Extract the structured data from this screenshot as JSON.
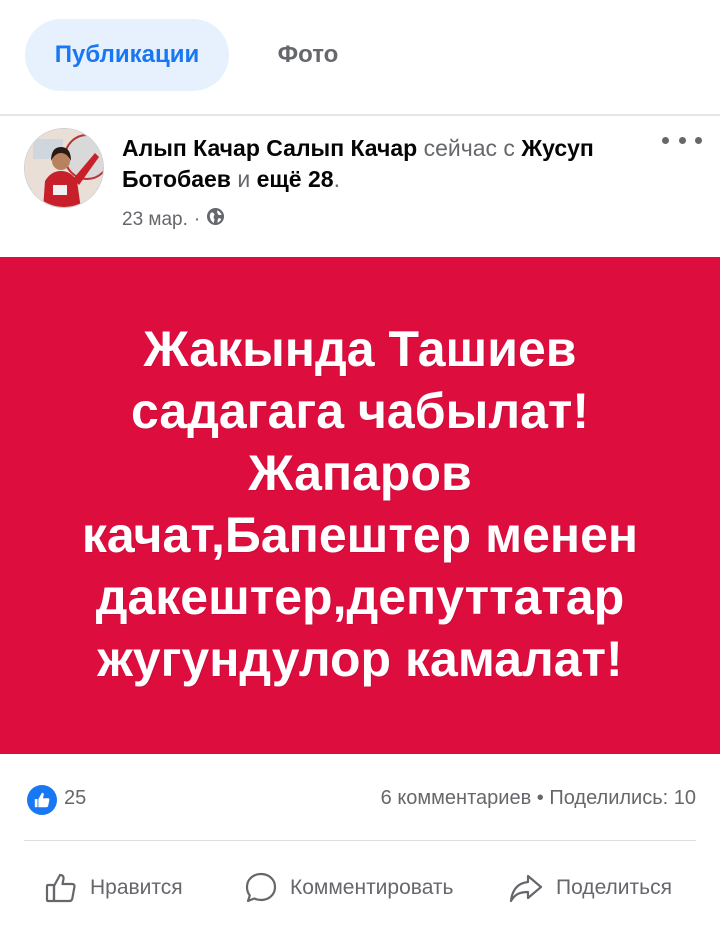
{
  "tabs": {
    "active": "Публикации",
    "inactive": "Фото"
  },
  "post": {
    "author": "Алып Качар Салып Качар",
    "with_prefix": "сейчас с",
    "with_person": "Жусуп Ботобаев",
    "and_word": "и",
    "others": "ещё 28",
    "period": ".",
    "date": "23 мар.",
    "separator": "·",
    "privacy_icon": "globe-icon",
    "banner_lines": [
      "Жакында Ташиев",
      "садагага чабылат!",
      "Жапаров",
      "качат,Бапештер менен",
      "дакештер,депуттатар",
      "жугундулор камалат!"
    ],
    "banner_color": "#dd0d3e"
  },
  "stats": {
    "likes": "25",
    "comments": "6 комментариев",
    "dot": "•",
    "shares": "Поделились: 10"
  },
  "actions": {
    "like": "Нравится",
    "comment": "Комментировать",
    "share": "Поделиться"
  },
  "colors": {
    "accent": "#1877f2",
    "muted": "#65676b"
  }
}
